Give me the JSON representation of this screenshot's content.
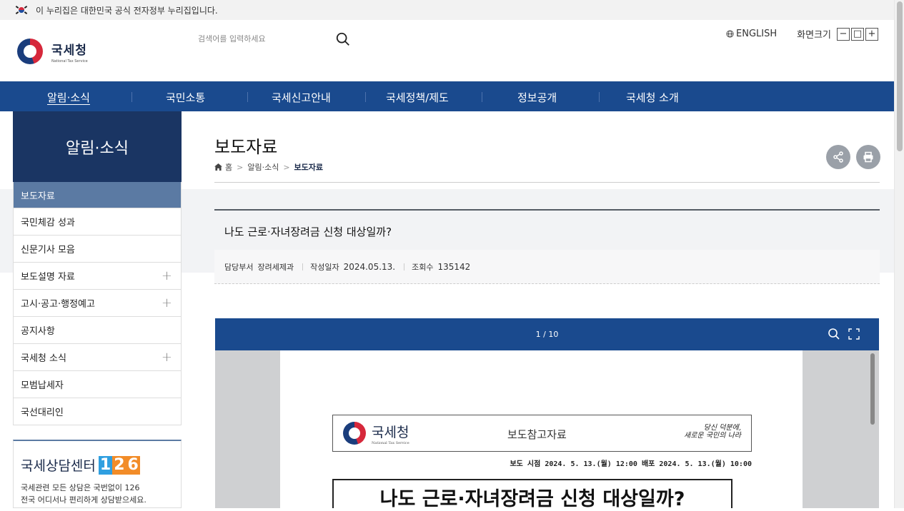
{
  "gov_banner": {
    "text": "이 누리집은 대한민국 공식 전자정부 누리집입니다."
  },
  "header": {
    "logo_name": "국세청",
    "logo_sub": "National Tax Service",
    "search_placeholder": "검색어를 입력하세요",
    "english_label": "ENGLISH",
    "zoom_label": "화면크기",
    "zoom_out": "−",
    "zoom_reset": "□",
    "zoom_in": "+"
  },
  "nav": {
    "items": [
      "알림·소식",
      "국민소통",
      "국세신고안내",
      "국세정책/제도",
      "정보공개",
      "국세청 소개"
    ]
  },
  "sidebar": {
    "title": "알림·소식",
    "items": [
      {
        "label": "보도자료",
        "expand": ""
      },
      {
        "label": "국민체감 성과",
        "expand": ""
      },
      {
        "label": "신문기사 모음",
        "expand": ""
      },
      {
        "label": "보도설명 자료",
        "expand": "+"
      },
      {
        "label": "고시·공고·행정예고",
        "expand": "+"
      },
      {
        "label": "공지사항",
        "expand": ""
      },
      {
        "label": "국세청 소식",
        "expand": "+"
      },
      {
        "label": "모범납세자",
        "expand": ""
      },
      {
        "label": "국선대리인",
        "expand": ""
      }
    ],
    "center_title": "국세상담센터",
    "center_num": [
      "1",
      "2",
      "6"
    ],
    "center_desc1": "국세관련 모든 상담은 국번없이 126",
    "center_desc2": "전국 어디서나 편리하게 상담받으세요."
  },
  "page": {
    "title": "보도자료",
    "breadcrumb": [
      "홈",
      "알림·소식",
      "보도자료"
    ]
  },
  "article": {
    "title": "나도 근로·자녀장려금 신청 대상일까?",
    "dept_label": "담당부서",
    "dept": "장려세제과",
    "date_label": "작성일자",
    "date": "2024.05.13.",
    "views_label": "조회수",
    "views": "135142"
  },
  "viewer": {
    "page_indicator": "1 / 10",
    "doc_org": "국세청",
    "doc_org_sub": "National Tax Service",
    "doc_type": "보도참고자료",
    "doc_slogan_1": "당신 덕분에,",
    "doc_slogan_2": "새로운 국민의 나라",
    "doc_release": "보도 시점  2024. 5. 13.(월) 12:00  배포  2024. 5. 13.(월) 10:00",
    "doc_title": "나도 근로·자녀장려금 신청 대상일까?"
  },
  "colors": {
    "nav": "#1a4a8e",
    "side_head": "#1a3563",
    "side_active": "#5b7aa3",
    "num_orange": "#f28c28",
    "num_blue": "#2f9fe0"
  }
}
